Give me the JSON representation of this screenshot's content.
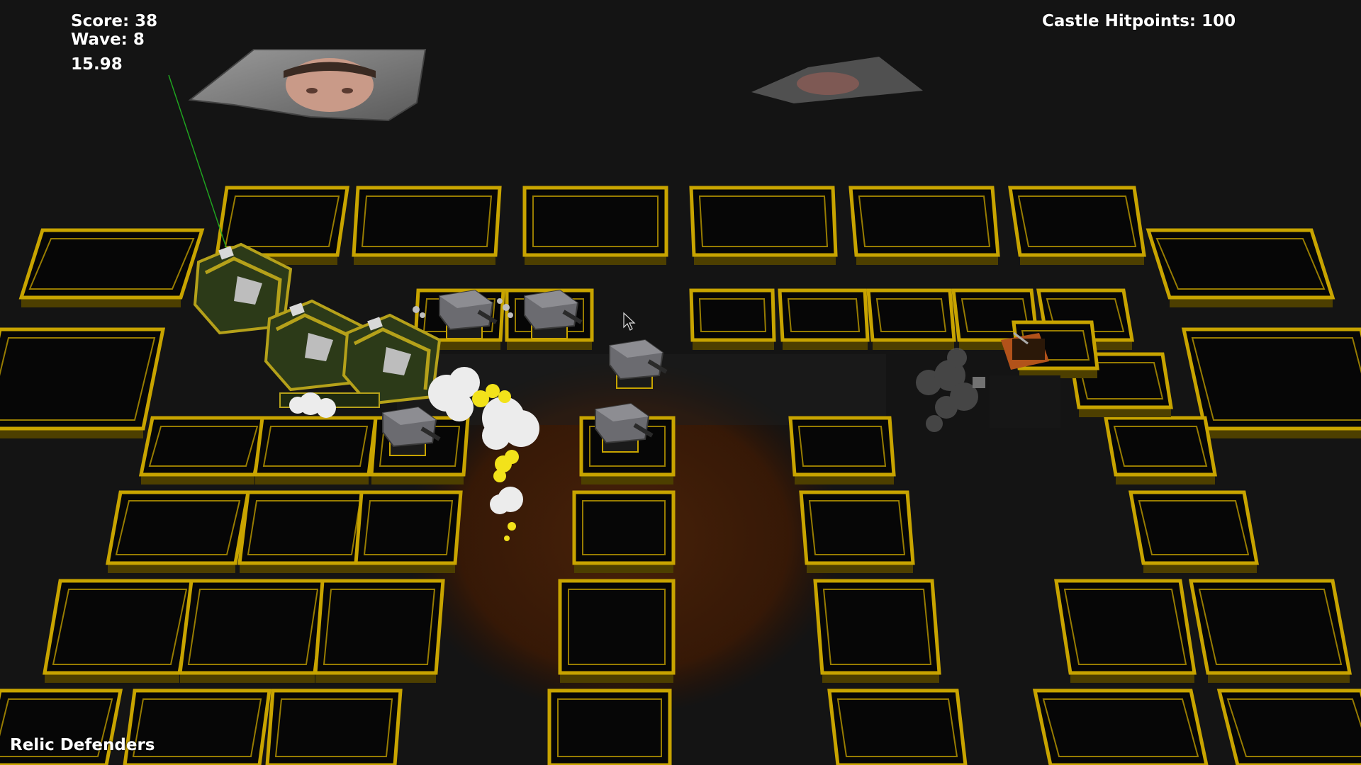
{
  "hud": {
    "score_label": "Score:",
    "score_value": "38",
    "wave_label": "Wave:",
    "wave_value": "8",
    "timer": "15.98",
    "castle_hp_label": "Castle Hitpoints:",
    "castle_hp_value": "100",
    "game_title": "Relic Defenders"
  },
  "theme": {
    "background": "#141414",
    "tile_top": "#060606",
    "tile_edge_gold": "#c8a400",
    "tile_edge_dark": "#4d3f00",
    "path_glow": "#3d1c05",
    "tower_gray": "#6b6b70",
    "enemy_green": "#2c3a18",
    "enemy_yellow": "#b5a11a",
    "explosion_yellow": "#f2e21a",
    "smoke_white": "#ececec",
    "castle_orange": "#b2521a"
  },
  "scene": {
    "towers": [
      {
        "id": "tower-1",
        "icon": "cannon-tower-icon"
      },
      {
        "id": "tower-2",
        "icon": "cannon-tower-icon"
      },
      {
        "id": "tower-3",
        "icon": "cannon-tower-icon"
      },
      {
        "id": "tower-4",
        "icon": "cannon-tower-icon"
      },
      {
        "id": "tower-5",
        "icon": "cannon-tower-icon"
      }
    ],
    "enemies": [
      {
        "id": "enemy-1",
        "icon": "armored-tank-enemy-icon"
      },
      {
        "id": "enemy-2",
        "icon": "armored-tank-enemy-icon"
      },
      {
        "id": "enemy-3",
        "icon": "armored-tank-enemy-icon"
      }
    ],
    "castle_icon": "castle-icon",
    "face_banners": [
      "face-banner-icon",
      "face-banner-icon"
    ]
  }
}
